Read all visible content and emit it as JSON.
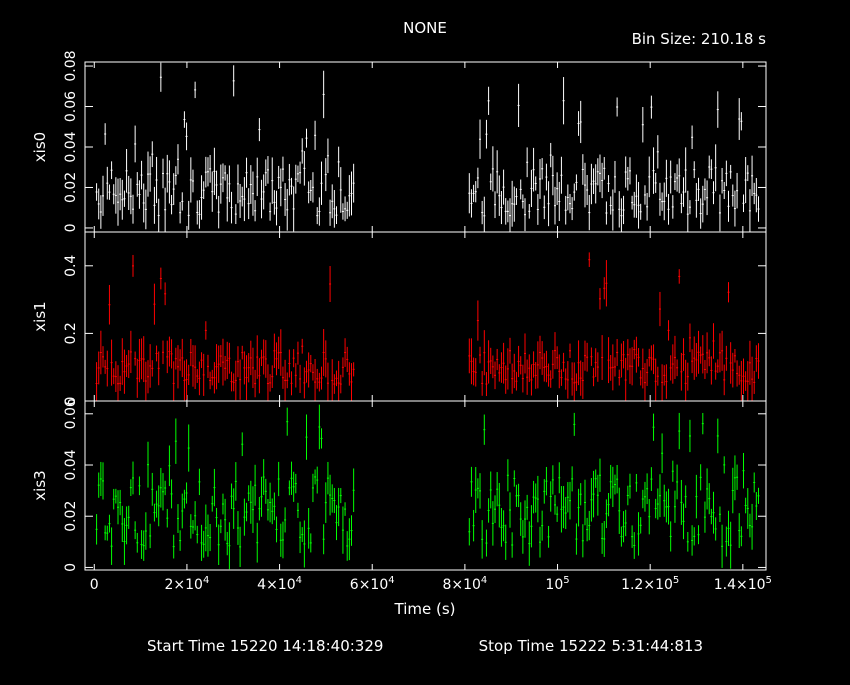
{
  "title": "NONE",
  "bin_size": "Bin Size: 210.18 s",
  "footer": {
    "start": "Start Time 15220 14:18:40:329",
    "stop": "Stop Time 15222  5:31:44:813"
  },
  "chart_data": {
    "type": "line",
    "xlabel": "Time (s)",
    "xlim": [
      -2000,
      145000
    ],
    "x_ticks": [
      {
        "value": 0,
        "label": "0"
      },
      {
        "value": 20000,
        "label": "2×10",
        "exp": "4"
      },
      {
        "value": 40000,
        "label": "4×10",
        "exp": "4"
      },
      {
        "value": 60000,
        "label": "6×10",
        "exp": "4"
      },
      {
        "value": 80000,
        "label": "8×10",
        "exp": "4"
      },
      {
        "value": 100000,
        "label": "10",
        "exp": "5"
      },
      {
        "value": 120000,
        "label": "1.2×10",
        "exp": "5"
      },
      {
        "value": 140000,
        "label": "1.4×10",
        "exp": "5"
      }
    ],
    "gaps": [
      [
        56000,
        80500
      ]
    ],
    "panels": [
      {
        "name": "xis0",
        "color": "#ffffff",
        "ylim": [
          -0.002,
          0.082
        ],
        "baseline": 0.018,
        "spread": 0.012,
        "peak_prob": 0.12,
        "peak_max": 0.075,
        "y_ticks": [
          {
            "value": 0,
            "label": "0"
          },
          {
            "value": 0.02,
            "label": "0.02"
          },
          {
            "value": 0.04,
            "label": "0.04"
          },
          {
            "value": 0.06,
            "label": "0.06"
          },
          {
            "value": 0.08,
            "label": "0.08"
          }
        ]
      },
      {
        "name": "xis1",
        "color": "#ff0000",
        "ylim": [
          0.0,
          0.5
        ],
        "baseline": 0.1,
        "spread": 0.05,
        "peak_prob": 0.08,
        "peak_max": 0.42,
        "y_ticks": [
          {
            "value": 0,
            "label": "0"
          },
          {
            "value": 0.2,
            "label": "0.2"
          },
          {
            "value": 0.4,
            "label": "0.4"
          }
        ]
      },
      {
        "name": "xis3",
        "color": "#00ff00",
        "ylim": [
          -0.001,
          0.065
        ],
        "baseline": 0.022,
        "spread": 0.014,
        "peak_prob": 0.12,
        "peak_max": 0.058,
        "y_ticks": [
          {
            "value": 0,
            "label": "0"
          },
          {
            "value": 0.02,
            "label": "0.02"
          },
          {
            "value": 0.04,
            "label": "0.04"
          },
          {
            "value": 0.06,
            "label": "0.06"
          }
        ]
      }
    ]
  }
}
